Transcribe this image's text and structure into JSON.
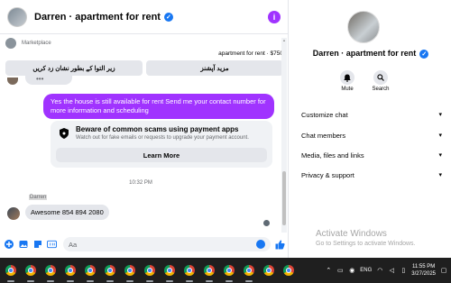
{
  "header": {
    "title": "Darren · apartment for rent",
    "info_icon": "i"
  },
  "marketplace": {
    "label": "Marketplace",
    "listing": "apartment for rent · $750",
    "quick_replies": [
      "زیر التوا کے بطور نشان زد کریں",
      "مزید آپشنز"
    ]
  },
  "messages": {
    "dots": "•••",
    "outgoing": "Yes the house is still available for rent Send me your contact number for more  information and  scheduling",
    "scam_title": "Beware of common scams using payment apps",
    "scam_sub": "Watch out for fake emails or requests to upgrade your payment account.",
    "learn_more": "Learn More",
    "time": "10:32 PM",
    "sender": "Darren",
    "incoming": "Awesome 854 894 2080"
  },
  "composer": {
    "placeholder": "Aa"
  },
  "info_panel": {
    "name": "Darren · apartment for rent",
    "mute_label": "Mute",
    "search_label": "Search",
    "menu": [
      "Customize chat",
      "Chat members",
      "Media, files and links",
      "Privacy & support"
    ]
  },
  "watermark": {
    "title": "Activate Windows",
    "subtitle": "Go to Settings to activate Windows."
  },
  "taskbar": {
    "app_count": 15,
    "lang": "ENG",
    "time": "11:55 PM",
    "date": "3/27/2025"
  },
  "colors": {
    "accent": "#a033ff",
    "brand": "#1877f2"
  },
  "icons": [
    "verified-icon",
    "info-icon",
    "shield-icon",
    "bell-icon",
    "search-icon",
    "chevron-down-icon",
    "plus-icon",
    "image-icon",
    "sticker-icon",
    "gif-icon",
    "emoji-icon",
    "like-icon",
    "chrome-icon"
  ]
}
